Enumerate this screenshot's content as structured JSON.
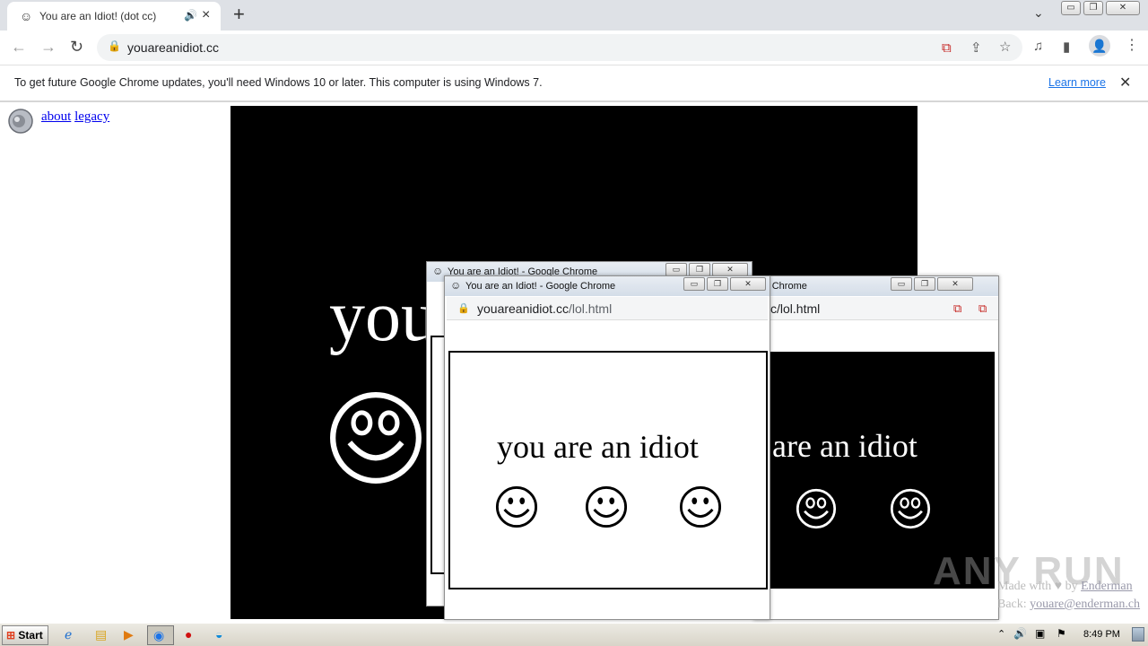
{
  "browser": {
    "tab_title": "You are an Idiot! (dot cc)",
    "tab_favicon": "smiley-icon",
    "url": "youareanidiot.cc"
  },
  "infobar": {
    "message": "To get future Google Chrome updates, you'll need Windows 10 or later. This computer is using Windows 7.",
    "learn_more": "Learn more"
  },
  "page": {
    "links": [
      "about",
      "legacy"
    ],
    "big_text": "you",
    "footer_made": "Made with",
    "footer_by": "by",
    "footer_author": "Enderman",
    "footer_contact_label": "Back:",
    "footer_contact": "youare@enderman.ch"
  },
  "popups": [
    {
      "title": "You are an Idiot! - Google Chrome",
      "url_host": "youareanidiot.cc",
      "url_path": "/lol.html",
      "text": "you are an idiot"
    },
    {
      "title": "You are an Idiot! - Google Chrome",
      "url_host": "youareanidiot.cc",
      "url_path": "/lol.html",
      "text": "you are an idiot"
    },
    {
      "title": "gle Chrome",
      "url_host": "",
      "url_path": "c/lol.html",
      "text": "are an idiot"
    }
  ],
  "taskbar": {
    "start_label": "Start",
    "clock": "8:49 PM"
  },
  "watermark": "ANY RUN"
}
